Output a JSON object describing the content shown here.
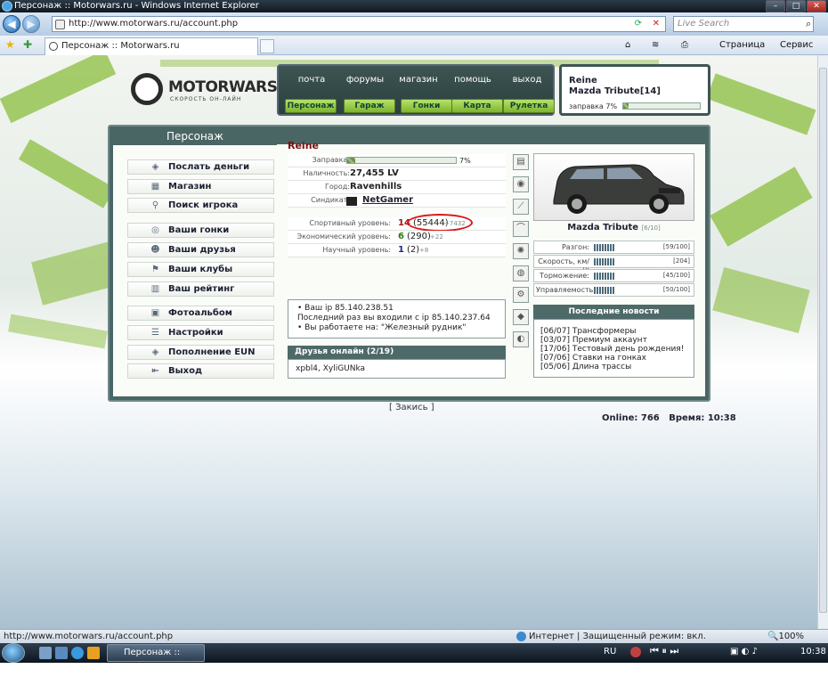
{
  "browser": {
    "title": "Персонаж :: Motorwars.ru - Windows Internet Explorer",
    "url": "http://www.motorwars.ru/account.php",
    "search_placeholder": "Live Search",
    "tab_label": "Персонаж :: Motorwars.ru",
    "toolbar": {
      "page_label": "Страница",
      "tools_label": "Сервис"
    },
    "window_buttons": {
      "minimize": "–",
      "maximize": "□",
      "close": "✕"
    }
  },
  "site": {
    "logo_name": "MOTORWARS.RU",
    "logo_tagline": "СКОРОСТЬ ОН-ЛАЙН",
    "top_menu": [
      "почта",
      "форумы",
      "магазин",
      "помощь",
      "выход"
    ],
    "green_menu": [
      "Персонаж",
      "Гараж",
      "Гонки",
      "Карта",
      "Рулетка"
    ],
    "user": {
      "name": "Reine",
      "car": "Mazda Tribute[14]",
      "fuel_label": "заправка 7%",
      "fuel_fraction": 0.07
    }
  },
  "panel": {
    "title": "Персонаж",
    "left_menu_group1": [
      "Послать деньги",
      "Магазин",
      "Поиск игрока"
    ],
    "left_menu_group2": [
      "Ваши гонки",
      "Ваши друзья",
      "Ваши клубы",
      "Ваш рейтинг"
    ],
    "left_menu_group3": [
      "Фотоальбом",
      "Настройки",
      "Пополнение EUN",
      "Выход"
    ],
    "player_name": "Reine",
    "fuel": {
      "label": "Заправка:",
      "value": "7%",
      "fraction": 0.07
    },
    "cash": {
      "label": "Наличность:",
      "value": "27,455 LV"
    },
    "city": {
      "label": "Город:",
      "value": "Ravenhills"
    },
    "syndicate": {
      "label": "Синдикат:",
      "value": "NetGamer"
    },
    "sport": {
      "label": "Спортивный уровень:",
      "level": "14",
      "points": "(55444)",
      "delta": "+7432"
    },
    "econ": {
      "label": "Экономический уровень:",
      "level": "6",
      "points": "(290)",
      "delta": "+22"
    },
    "science": {
      "label": "Научный уровень:",
      "level": "1",
      "points": "(2)",
      "delta": "+8"
    },
    "ip_lines": [
      "Ваш ip 85.140.238.51",
      "Последний раз вы входили с ip 85.140.237.64",
      "Вы работаете на: \"Железный рудник\""
    ],
    "friends_header": "Друзья онлайн (2/19)",
    "friends_list": "xpbl4, XyliGUNka",
    "car": {
      "name": "Mazda Tribute",
      "slot": "[6/10]"
    },
    "stats": [
      {
        "label": "Разгон:",
        "value": "[59/100]"
      },
      {
        "label": "Скорость, км/ч:",
        "value": "[204]"
      },
      {
        "label": "Торможение:",
        "value": "[45/100]"
      },
      {
        "label": "Управляемость:",
        "value": "[50/100]"
      }
    ],
    "news_header": "Последние новости",
    "news": [
      "[06/07] Трансформеры",
      "[03/07] Премиум аккаунт",
      "[17/06] Тестовый день рождения!",
      "[07/06] Ставки на гонках",
      "[05/06] Длина трассы"
    ]
  },
  "footer": {
    "bookmark": "[ Закись ]",
    "online_label": "Online:",
    "online_value": "766",
    "time_label": "Время:",
    "time_value": "10:38"
  },
  "statusbar": {
    "url": "http://www.motorwars.ru/account.php",
    "zone": "Интернет | Защищенный режим: вкл.",
    "zoom": "100%"
  },
  "taskbar": {
    "task_label": "Персонаж :: Motor...",
    "lang": "RU",
    "clock": "10:38"
  },
  "colors": {
    "accent_green": "#8bbd3e",
    "panel_dark": "#4a6664",
    "name_red": "#7a1010",
    "highlight_circle": "#d81818"
  }
}
